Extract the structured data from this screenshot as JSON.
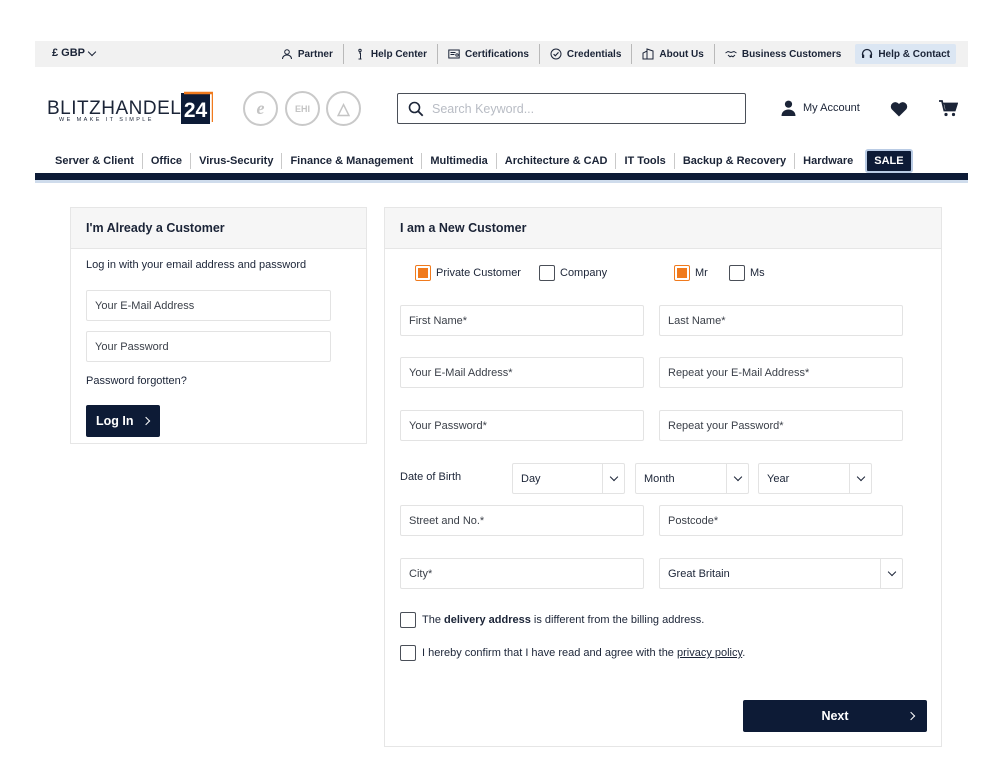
{
  "topbar": {
    "currency": "£ GBP",
    "links": [
      {
        "label": "Partner",
        "icon": "partner-icon"
      },
      {
        "label": "Help Center",
        "icon": "info-icon"
      },
      {
        "label": "Certifications",
        "icon": "certificate-icon"
      },
      {
        "label": "Credentials",
        "icon": "badge-check-icon"
      },
      {
        "label": "About Us",
        "icon": "building-icon"
      },
      {
        "label": "Business Customers",
        "icon": "handshake-icon"
      }
    ],
    "help_contact": "Help & Contact"
  },
  "header": {
    "logo_text": "BLITZHANDEL",
    "logo_tagline": "WE MAKE IT SIMPLE",
    "logo_mark": "24",
    "seals": [
      "e",
      "EHI",
      "△"
    ],
    "search_placeholder": "Search Keyword...",
    "account_label": "My Account"
  },
  "nav": {
    "items": [
      "Server & Client",
      "Office",
      "Virus-Security",
      "Finance & Management",
      "Multimedia",
      "Architecture & CAD",
      "IT Tools",
      "Backup & Recovery",
      "Hardware"
    ],
    "sale": "SALE"
  },
  "login": {
    "title": "I'm Already a Customer",
    "intro": "Log in with your email address and password",
    "email_placeholder": "Your E-Mail Address",
    "password_placeholder": "Your Password",
    "forgot": "Password forgotten?",
    "button": "Log In"
  },
  "register": {
    "title": "I am a New Customer",
    "customer_type": {
      "private": "Private Customer",
      "company": "Company",
      "private_checked": true
    },
    "salutation": {
      "mr": "Mr",
      "ms": "Ms",
      "mr_checked": true
    },
    "first_name": "First Name*",
    "last_name": "Last Name*",
    "email": "Your E-Mail Address*",
    "email_repeat": "Repeat your E-Mail Address*",
    "password": "Your Password*",
    "password_repeat": "Repeat your Password*",
    "dob_label": "Date of Birth",
    "dob_day": "Day",
    "dob_month": "Month",
    "dob_year": "Year",
    "street": "Street and No.*",
    "postcode": "Postcode*",
    "city": "City*",
    "country": "Great Britain",
    "delivery_pre": "The ",
    "delivery_bold": "delivery address",
    "delivery_post": " is different from the billing address.",
    "privacy_pre": "I hereby confirm that I have read and agree with the ",
    "privacy_link": "privacy policy",
    "privacy_post": ".",
    "next_button": "Next"
  },
  "colors": {
    "navy": "#0d1b36",
    "accent": "#f07a1d",
    "help_bg": "#dbe6f3"
  }
}
